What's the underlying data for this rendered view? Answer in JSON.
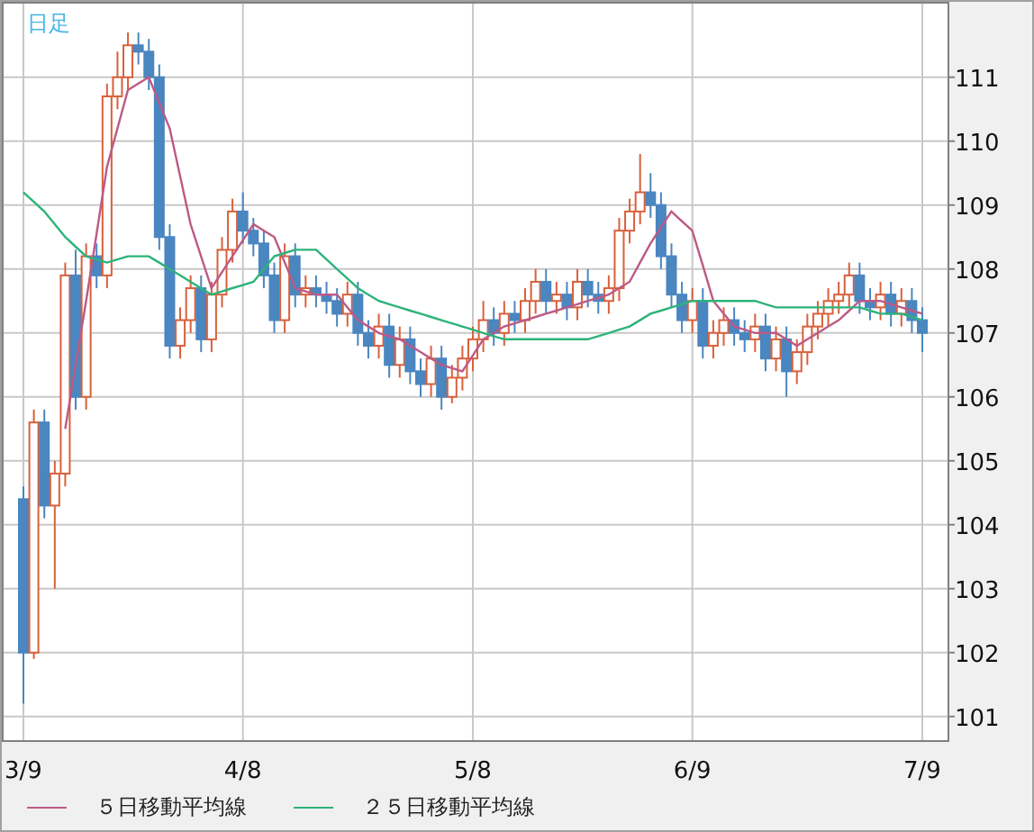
{
  "chart": {
    "chart_data": {
      "type": "candlestick",
      "title": "日足",
      "categories": [
        "3/9",
        null,
        null,
        null,
        null,
        null,
        null,
        null,
        null,
        null,
        null,
        null,
        null,
        null,
        null,
        null,
        null,
        null,
        null,
        null,
        null,
        "4/8",
        null,
        null,
        null,
        null,
        null,
        null,
        null,
        null,
        null,
        null,
        null,
        null,
        null,
        null,
        null,
        null,
        null,
        null,
        null,
        null,
        null,
        "5/8",
        null,
        null,
        null,
        null,
        null,
        null,
        null,
        null,
        null,
        null,
        null,
        null,
        null,
        null,
        null,
        null,
        null,
        null,
        null,
        null,
        "6/9",
        null,
        null,
        null,
        null,
        null,
        null,
        null,
        null,
        null,
        null,
        null,
        null,
        null,
        null,
        null,
        null,
        null,
        null,
        null,
        null,
        null,
        "7/9"
      ],
      "ohlc": [
        [
          104.4,
          104.6,
          101.2,
          102.0
        ],
        [
          102.0,
          105.8,
          101.9,
          105.6
        ],
        [
          105.6,
          105.8,
          104.1,
          104.3
        ],
        [
          104.3,
          105.0,
          103.0,
          104.8
        ],
        [
          104.8,
          108.1,
          104.6,
          107.9
        ],
        [
          107.9,
          108.3,
          105.8,
          106.0
        ],
        [
          106.0,
          108.4,
          105.8,
          108.2
        ],
        [
          108.2,
          108.4,
          107.7,
          107.9
        ],
        [
          107.9,
          110.9,
          107.7,
          110.7
        ],
        [
          110.7,
          111.4,
          110.5,
          111.0
        ],
        [
          111.0,
          111.7,
          110.8,
          111.5
        ],
        [
          111.5,
          111.7,
          111.2,
          111.4
        ],
        [
          111.4,
          111.6,
          110.8,
          111.0
        ],
        [
          111.0,
          111.2,
          108.3,
          108.5
        ],
        [
          108.5,
          108.7,
          106.6,
          106.8
        ],
        [
          106.8,
          107.4,
          106.6,
          107.2
        ],
        [
          107.2,
          107.9,
          107.0,
          107.7
        ],
        [
          107.7,
          107.9,
          106.7,
          106.9
        ],
        [
          106.9,
          107.8,
          106.7,
          107.6
        ],
        [
          107.6,
          108.5,
          107.4,
          108.3
        ],
        [
          108.3,
          109.1,
          108.1,
          108.9
        ],
        [
          108.9,
          109.2,
          108.4,
          108.6
        ],
        [
          108.6,
          108.8,
          108.2,
          108.4
        ],
        [
          108.4,
          108.6,
          107.7,
          107.9
        ],
        [
          107.9,
          108.1,
          107.0,
          107.2
        ],
        [
          107.2,
          108.4,
          107.0,
          108.2
        ],
        [
          108.2,
          108.4,
          107.4,
          107.6
        ],
        [
          107.6,
          107.9,
          107.4,
          107.7
        ],
        [
          107.7,
          107.9,
          107.4,
          107.6
        ],
        [
          107.6,
          107.8,
          107.3,
          107.5
        ],
        [
          107.5,
          107.7,
          107.1,
          107.3
        ],
        [
          107.3,
          107.8,
          107.1,
          107.6
        ],
        [
          107.6,
          107.8,
          106.8,
          107.0
        ],
        [
          107.0,
          107.2,
          106.6,
          106.8
        ],
        [
          106.8,
          107.3,
          106.6,
          107.1
        ],
        [
          107.1,
          107.3,
          106.3,
          106.5
        ],
        [
          106.5,
          107.1,
          106.3,
          106.9
        ],
        [
          106.9,
          107.1,
          106.2,
          106.4
        ],
        [
          106.4,
          106.6,
          106.0,
          106.2
        ],
        [
          106.2,
          106.8,
          106.0,
          106.6
        ],
        [
          106.6,
          106.8,
          105.8,
          106.0
        ],
        [
          106.0,
          106.5,
          105.9,
          106.3
        ],
        [
          106.3,
          106.8,
          106.1,
          106.6
        ],
        [
          106.6,
          107.1,
          106.4,
          106.9
        ],
        [
          106.9,
          107.5,
          106.7,
          107.2
        ],
        [
          107.2,
          107.4,
          106.8,
          107.0
        ],
        [
          107.0,
          107.5,
          106.8,
          107.3
        ],
        [
          107.3,
          107.5,
          107.0,
          107.2
        ],
        [
          107.2,
          107.7,
          107.0,
          107.5
        ],
        [
          107.5,
          108.0,
          107.3,
          107.8
        ],
        [
          107.8,
          108.0,
          107.3,
          107.5
        ],
        [
          107.5,
          107.8,
          107.3,
          107.6
        ],
        [
          107.6,
          107.8,
          107.2,
          107.4
        ],
        [
          107.4,
          108.0,
          107.2,
          107.8
        ],
        [
          107.8,
          108.0,
          107.4,
          107.6
        ],
        [
          107.6,
          107.8,
          107.3,
          107.5
        ],
        [
          107.5,
          107.9,
          107.3,
          107.7
        ],
        [
          107.7,
          108.8,
          107.5,
          108.6
        ],
        [
          108.6,
          109.1,
          108.4,
          108.9
        ],
        [
          108.9,
          109.8,
          108.7,
          109.2
        ],
        [
          109.2,
          109.5,
          108.8,
          109.0
        ],
        [
          109.0,
          109.2,
          108.0,
          108.2
        ],
        [
          108.2,
          108.4,
          107.4,
          107.6
        ],
        [
          107.6,
          107.8,
          107.0,
          107.2
        ],
        [
          107.2,
          107.7,
          107.0,
          107.5
        ],
        [
          107.5,
          107.7,
          106.6,
          106.8
        ],
        [
          106.8,
          107.2,
          106.6,
          107.0
        ],
        [
          107.0,
          107.4,
          106.8,
          107.2
        ],
        [
          107.2,
          107.4,
          106.8,
          107.0
        ],
        [
          107.0,
          107.2,
          106.7,
          106.9
        ],
        [
          106.9,
          107.3,
          106.7,
          107.1
        ],
        [
          107.1,
          107.3,
          106.4,
          106.6
        ],
        [
          106.6,
          107.1,
          106.4,
          106.9
        ],
        [
          106.9,
          107.1,
          106.0,
          106.4
        ],
        [
          106.4,
          106.9,
          106.2,
          106.7
        ],
        [
          106.7,
          107.3,
          106.5,
          107.1
        ],
        [
          107.1,
          107.5,
          106.9,
          107.3
        ],
        [
          107.3,
          107.7,
          107.1,
          107.5
        ],
        [
          107.5,
          107.8,
          107.3,
          107.6
        ],
        [
          107.6,
          108.1,
          107.4,
          107.9
        ],
        [
          107.9,
          108.1,
          107.3,
          107.5
        ],
        [
          107.5,
          107.7,
          107.2,
          107.4
        ],
        [
          107.4,
          107.8,
          107.2,
          107.6
        ],
        [
          107.6,
          107.8,
          107.1,
          107.3
        ],
        [
          107.3,
          107.7,
          107.1,
          107.5
        ],
        [
          107.5,
          107.7,
          107.0,
          107.2
        ],
        [
          107.2,
          107.4,
          106.7,
          107.0
        ]
      ],
      "series": [
        {
          "name": "５日移動平均線",
          "type": "line",
          "color": "#bc5a86",
          "values": [
            null,
            null,
            null,
            null,
            105.5,
            106.5,
            107.5,
            108.55,
            109.6,
            110.2,
            110.8,
            110.9,
            111.0,
            110.6,
            110.2,
            109.45,
            108.7,
            108.2,
            107.7,
            107.95,
            108.2,
            108.45,
            108.7,
            108.6,
            108.5,
            108.1,
            107.7,
            107.65,
            107.6,
            107.6,
            107.6,
            107.4,
            107.2,
            107.1,
            107.0,
            106.95,
            106.9,
            106.8,
            106.7,
            106.6,
            106.5,
            106.45,
            106.4,
            106.65,
            106.9,
            107.0,
            107.1,
            107.15,
            107.2,
            107.25,
            107.3,
            107.35,
            107.4,
            107.45,
            107.5,
            107.55,
            107.6,
            107.7,
            107.8,
            108.1,
            108.4,
            108.65,
            108.9,
            108.75,
            108.6,
            108.05,
            107.5,
            107.3,
            107.1,
            107.05,
            107.0,
            107.0,
            107.0,
            106.9,
            106.8,
            106.9,
            107.0,
            107.1,
            107.2,
            107.35,
            107.5,
            107.5,
            107.5,
            107.45,
            107.4,
            107.35,
            107.3
          ]
        },
        {
          "name": "２５日移動平均線",
          "type": "line",
          "color": "#2db37a",
          "values": [
            109.2,
            109.05,
            108.9,
            108.7,
            108.5,
            108.35,
            108.2,
            108.15,
            108.1,
            108.15,
            108.2,
            108.2,
            108.2,
            108.1,
            108.0,
            107.9,
            107.8,
            107.7,
            107.6,
            107.65,
            107.7,
            107.75,
            107.8,
            108.0,
            108.2,
            108.25,
            108.3,
            108.3,
            108.3,
            108.15,
            108.0,
            107.85,
            107.7,
            107.6,
            107.5,
            107.45,
            107.4,
            107.35,
            107.3,
            107.25,
            107.2,
            107.15,
            107.1,
            107.05,
            107.0,
            106.95,
            106.9,
            106.9,
            106.9,
            106.9,
            106.9,
            106.9,
            106.9,
            106.9,
            106.9,
            106.95,
            107.0,
            107.05,
            107.1,
            107.2,
            107.3,
            107.35,
            107.4,
            107.45,
            107.5,
            107.5,
            107.5,
            107.5,
            107.5,
            107.5,
            107.5,
            107.45,
            107.4,
            107.4,
            107.4,
            107.4,
            107.4,
            107.4,
            107.4,
            107.4,
            107.4,
            107.35,
            107.3,
            107.3,
            107.3,
            107.25,
            107.2
          ]
        }
      ],
      "ylim": [
        100.63,
        112.18
      ],
      "grid": true,
      "yticks": [
        101,
        102,
        103,
        104,
        105,
        106,
        107,
        108,
        109,
        110,
        111
      ]
    }
  }
}
